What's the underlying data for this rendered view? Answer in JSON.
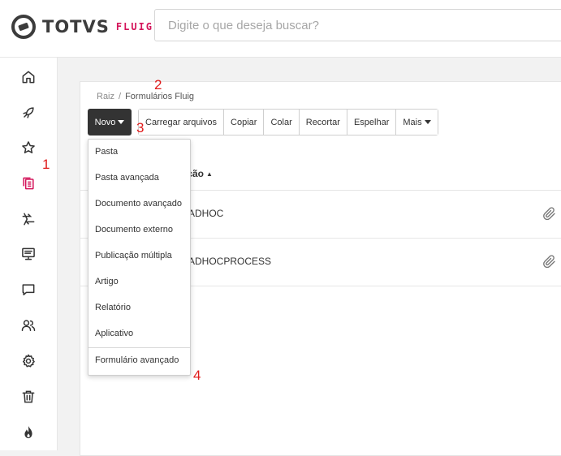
{
  "header": {
    "logo_text": "TOTVS",
    "logo_sub": "FLUIG",
    "search_placeholder": "Digite o que deseja buscar?"
  },
  "sidebar": {
    "items": [
      {
        "icon": "home-icon"
      },
      {
        "icon": "rocket-icon"
      },
      {
        "icon": "star-icon"
      },
      {
        "icon": "documents-icon",
        "active": true
      },
      {
        "icon": "process-arrows-icon"
      },
      {
        "icon": "presentation-icon"
      },
      {
        "icon": "chat-icon"
      },
      {
        "icon": "users-icon"
      },
      {
        "icon": "gear-icon"
      },
      {
        "icon": "trash-icon"
      },
      {
        "icon": "flame-icon"
      }
    ]
  },
  "breadcrumb": {
    "root": "Raiz",
    "separator": "/",
    "current": "Formulários Fluig"
  },
  "toolbar": {
    "novo_label": "Novo",
    "buttons": [
      "Carregar arquivos",
      "Copiar",
      "Colar",
      "Recortar",
      "Espelhar",
      "Mais"
    ]
  },
  "table": {
    "column_header": "ição",
    "rows": [
      {
        "name": "ADHOC"
      },
      {
        "name": "ADHOCPROCESS"
      }
    ]
  },
  "dropdown": {
    "items": [
      "Pasta",
      "Pasta avançada",
      "Documento avançado",
      "Documento externo",
      "Publicação múltipla",
      "Artigo",
      "Relatório",
      "Aplicativo"
    ],
    "extra_item": "Formulário avançado"
  },
  "annotations": [
    "1",
    "2",
    "3",
    "4"
  ],
  "colors": {
    "accent": "#d4145a",
    "annotation": "#e01a1a",
    "novo_bg": "#333333"
  }
}
